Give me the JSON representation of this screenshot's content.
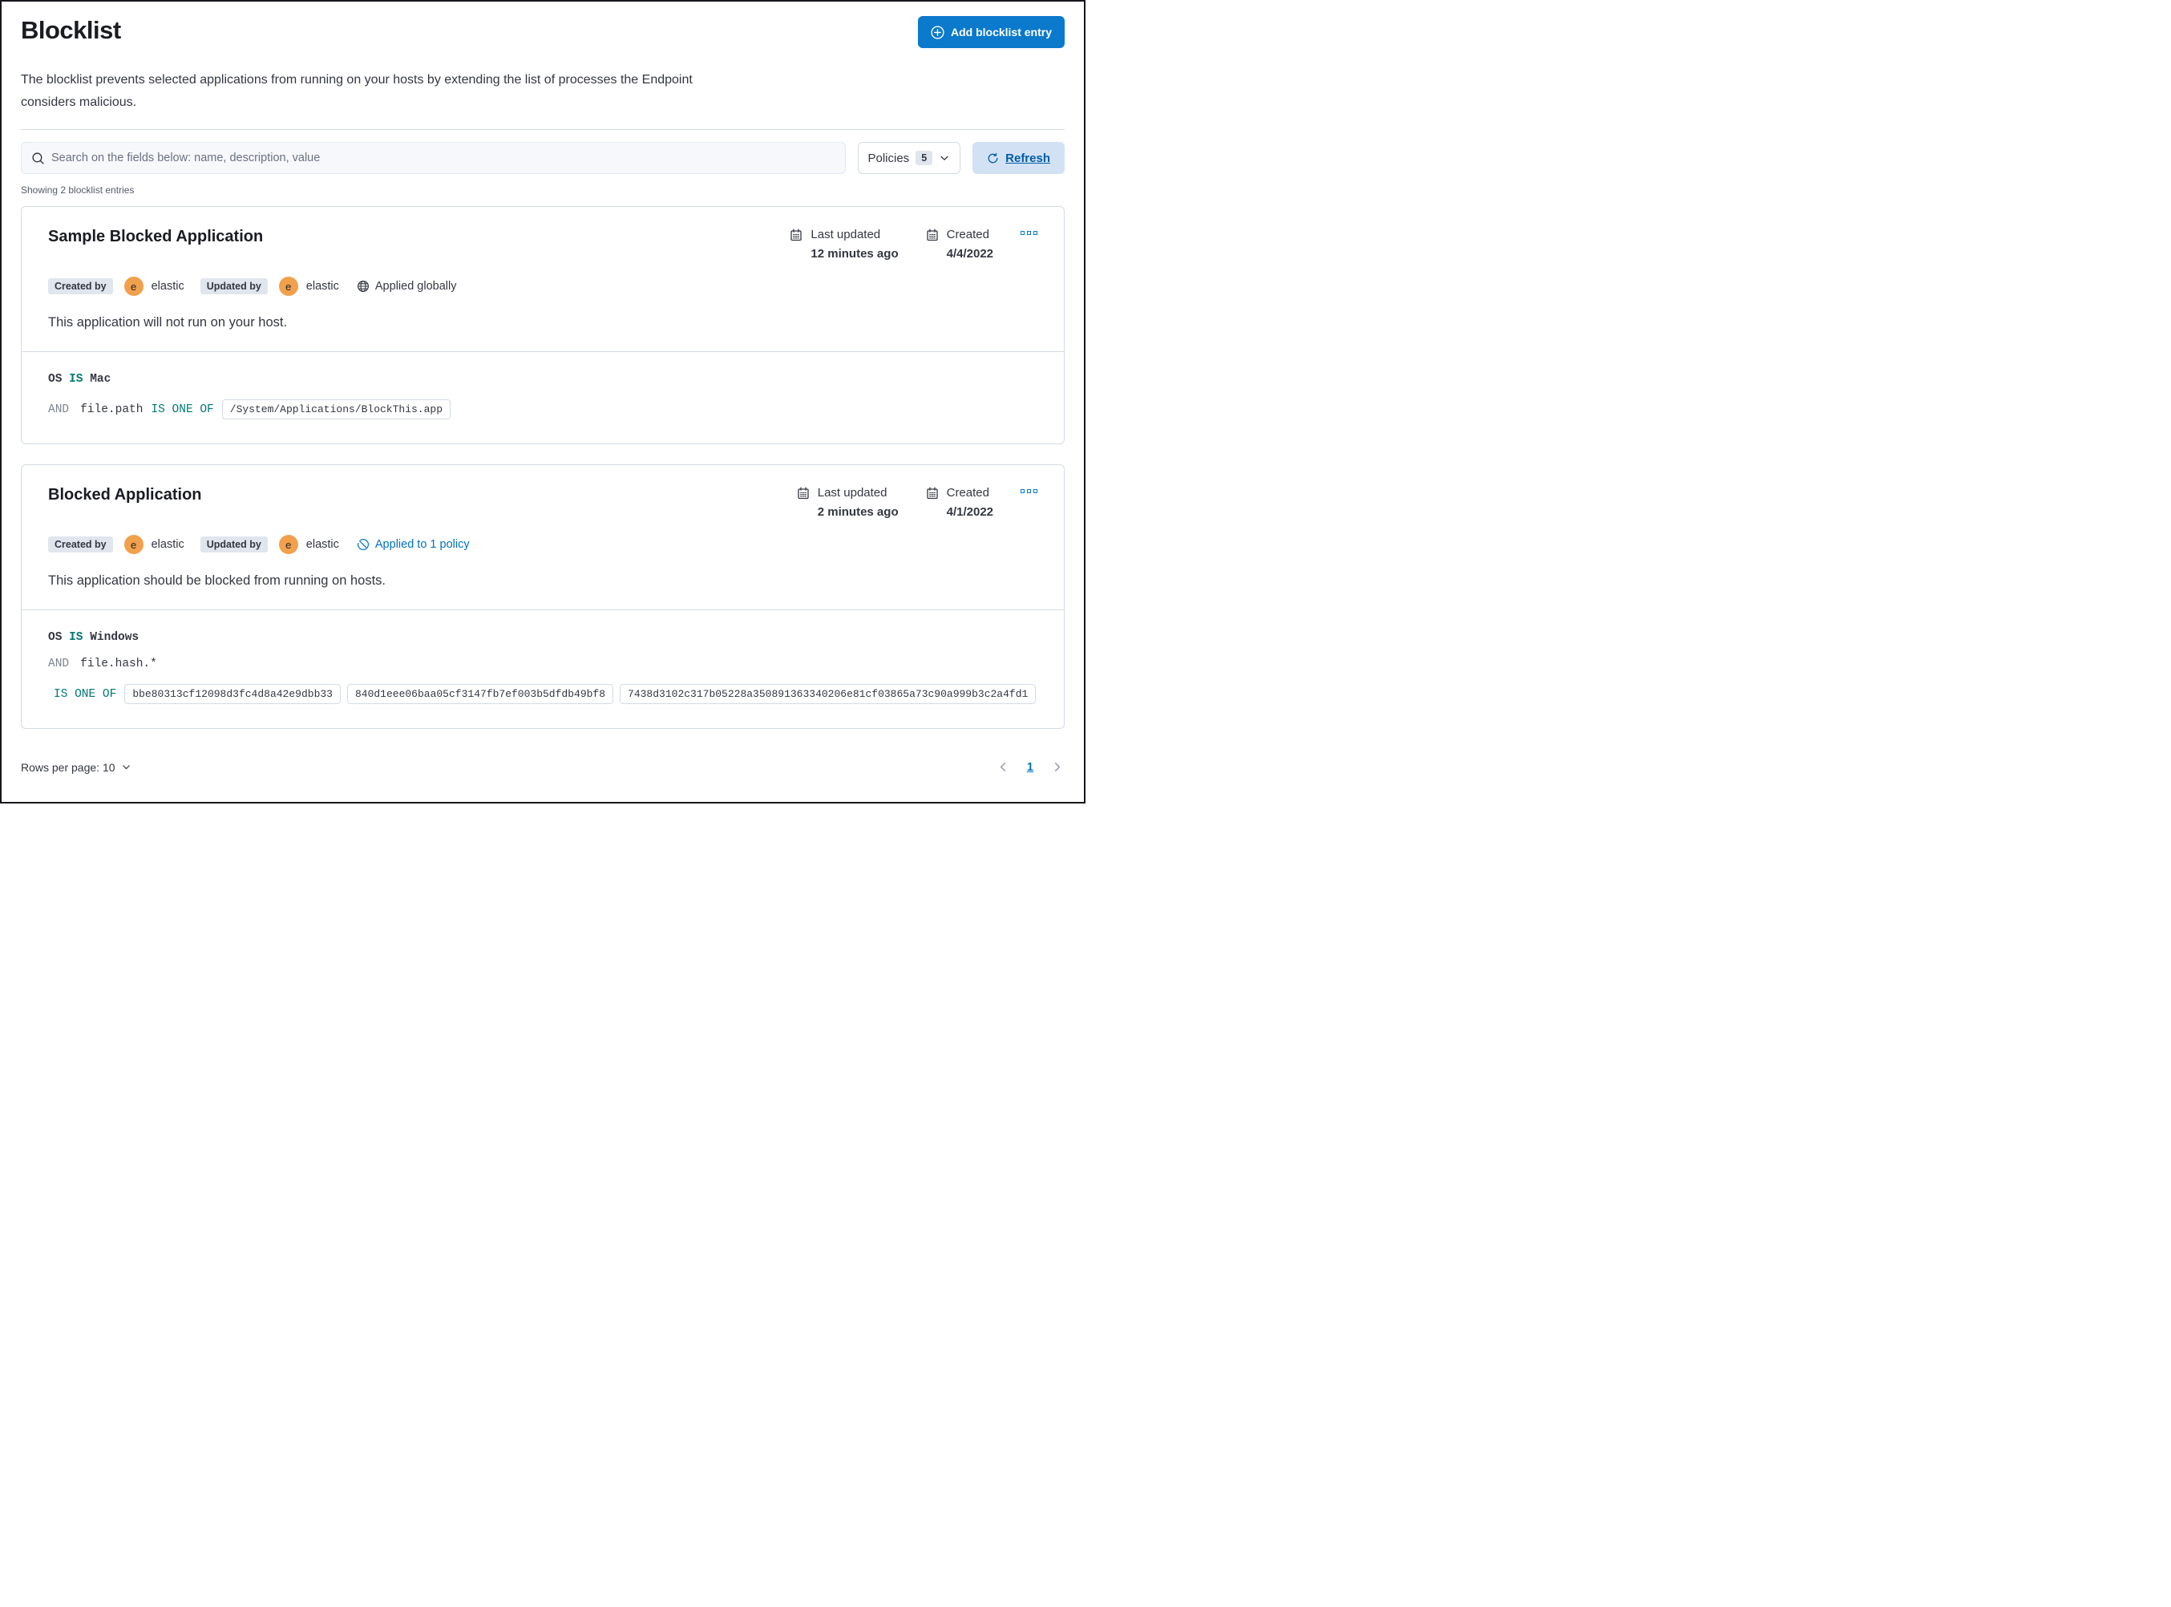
{
  "page": {
    "title": "Blocklist",
    "description": "The blocklist prevents selected applications from running on your hosts by extending the list of processes the Endpoint considers malicious.",
    "add_button_label": "Add blocklist entry"
  },
  "toolbar": {
    "search_placeholder": "Search on the fields below: name, description, value",
    "search_value": "",
    "policies_label": "Policies",
    "policies_count": "5",
    "refresh_label": "Refresh"
  },
  "summary": "Showing 2 blocklist entries",
  "entries": [
    {
      "title": "Sample Blocked Application",
      "created_by_label": "Created by",
      "created_by_avatar": "e",
      "created_by": "elastic",
      "updated_by_label": "Updated by",
      "updated_by_avatar": "e",
      "updated_by": "elastic",
      "scope_label": "Applied globally",
      "last_updated_label": "Last updated",
      "last_updated_value": "12 minutes ago",
      "created_label": "Created",
      "created_value": "4/4/2022",
      "description": "This application will not run on your host.",
      "criteria": {
        "os_field": "OS",
        "os_operator": "IS",
        "os_value": "Mac",
        "conditions": [
          {
            "conjunction": "AND",
            "field": "file.path",
            "operator": "IS ONE OF",
            "values": [
              "/System/Applications/BlockThis.app"
            ]
          }
        ]
      }
    },
    {
      "title": "Blocked Application",
      "created_by_label": "Created by",
      "created_by_avatar": "e",
      "created_by": "elastic",
      "updated_by_label": "Updated by",
      "updated_by_avatar": "e",
      "updated_by": "elastic",
      "scope_label": "Applied to 1 policy",
      "last_updated_label": "Last updated",
      "last_updated_value": "2 minutes ago",
      "created_label": "Created",
      "created_value": "4/1/2022",
      "description": "This application should be blocked from running on hosts.",
      "criteria": {
        "os_field": "OS",
        "os_operator": "IS",
        "os_value": "Windows",
        "conditions": [
          {
            "conjunction": "AND",
            "field": "file.hash.*",
            "operator": "IS ONE OF",
            "values": [
              "bbe80313cf12098d3fc4d8a42e9dbb33",
              "840d1eee06baa05cf3147fb7ef003b5dfdb49bf8",
              "7438d3102c317b05228a350891363340206e81cf03865a73c90a999b3c2a4fd1"
            ]
          }
        ]
      }
    }
  ],
  "footer": {
    "rows_per_page_label": "Rows per page: 10",
    "page_number": "1"
  },
  "colors": {
    "primary_button": "#0b79cc",
    "link_blue": "#0071c2",
    "refresh_bg": "#d2e2f4",
    "operator_teal": "#007871",
    "badge_bg": "#e0e5ee",
    "avatar_orange": "#f1a04c",
    "card_border": "#d3dae6",
    "text": "#343741",
    "heading": "#1a1c21"
  }
}
